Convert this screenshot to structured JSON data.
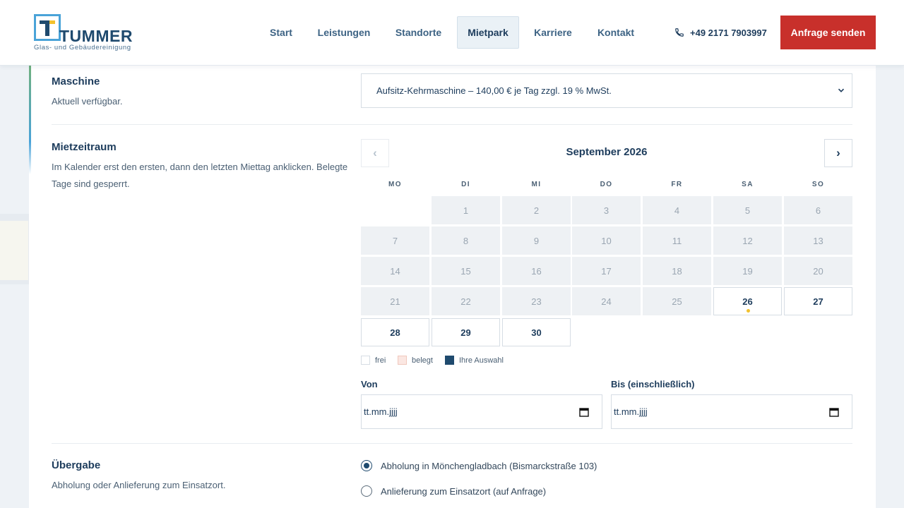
{
  "brand": {
    "name": "TUMMER",
    "tagline": "Glas- und Gebäudereinigung",
    "colors": {
      "primary": "#1f4a6e",
      "accent_blue": "#4aa3d8",
      "accent_yellow": "#f2c12e",
      "cta": "#c8302b"
    }
  },
  "nav": {
    "items": [
      {
        "label": "Start",
        "active": false
      },
      {
        "label": "Leistungen",
        "active": false
      },
      {
        "label": "Standorte",
        "active": false
      },
      {
        "label": "Mietpark",
        "active": true
      },
      {
        "label": "Karriere",
        "active": false
      },
      {
        "label": "Kontakt",
        "active": false
      }
    ],
    "phone": "+49 2171 7903997",
    "phone_icon": "phone-icon",
    "cta_label": "Anfrage senden"
  },
  "form": {
    "machine": {
      "title": "Maschine",
      "desc": "Aktuell verfügbar.",
      "selected": "Aufsitz-Kehrmaschine – 140,00 € je Tag zzgl. 19 % MwSt."
    },
    "period": {
      "title": "Mietzeitraum",
      "desc": "Im Kalender erst den ersten, dann den letzten Miettag anklicken. Belegte Tage sind gesperrt."
    },
    "calendar": {
      "month": "September 2026",
      "prev": "‹",
      "next": "›",
      "weekdays": [
        "MO",
        "DI",
        "MI",
        "DO",
        "FR",
        "SA",
        "SO"
      ],
      "days": [
        "1",
        "2",
        "3",
        "4",
        "5",
        "6",
        "7",
        "8",
        "9",
        "10",
        "11",
        "12",
        "13",
        "14",
        "15",
        "16",
        "17",
        "18",
        "19",
        "20",
        "21",
        "22",
        "23",
        "24",
        "25",
        "26",
        "27",
        "28",
        "29",
        "30"
      ],
      "first_available_day": 26,
      "today_marker_day": 26,
      "legend": {
        "free": "frei",
        "booked": "belegt",
        "selection": "Ihre Auswahl"
      }
    },
    "from": {
      "label": "Von",
      "placeholder": "tt.mm.jjjj"
    },
    "to": {
      "label": "Bis (einschließlich)",
      "placeholder": "tt.mm.jjjj"
    },
    "handover": {
      "title": "Übergabe",
      "desc": "Abholung oder Anlieferung zum Einsatzort.",
      "options": [
        {
          "label": "Abholung in Mönchengladbach (Bismarckstraße 103)",
          "checked": true
        },
        {
          "label": "Anlieferung zum Einsatzort (auf Anfrage)",
          "checked": false
        }
      ]
    }
  }
}
